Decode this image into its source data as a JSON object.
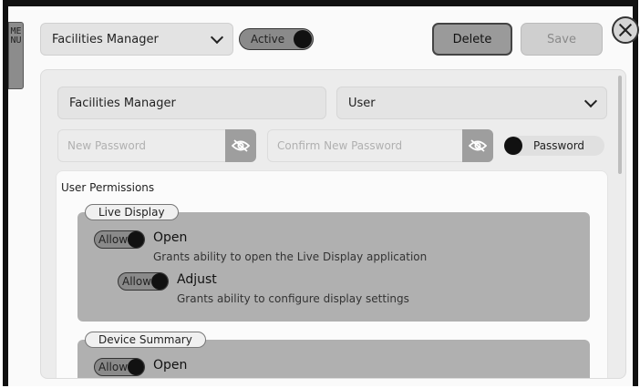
{
  "menu": {
    "label": "MENU"
  },
  "header": {
    "role_select": "Facilities Manager",
    "status_toggle": "Active",
    "delete_label": "Delete",
    "save_label": "Save"
  },
  "form": {
    "name_value": "Facilities Manager",
    "type_select": "User",
    "new_password_placeholder": "New Password",
    "confirm_password_placeholder": "Confirm New Password",
    "password_toggle_label": "Password"
  },
  "permissions": {
    "title": "User Permissions",
    "groups": [
      {
        "name": "Live Display",
        "items": [
          {
            "switch_label": "Allow",
            "title": "Open",
            "description": "Grants ability to open the Live Display application"
          },
          {
            "switch_label": "Allow",
            "title": "Adjust",
            "description": "Grants ability to configure display settings"
          }
        ]
      },
      {
        "name": "Device Summary",
        "items": [
          {
            "switch_label": "Allow",
            "title": "Open"
          }
        ]
      }
    ]
  },
  "icons": [
    "chevron-down-icon",
    "close-icon",
    "eye-off-icon"
  ]
}
